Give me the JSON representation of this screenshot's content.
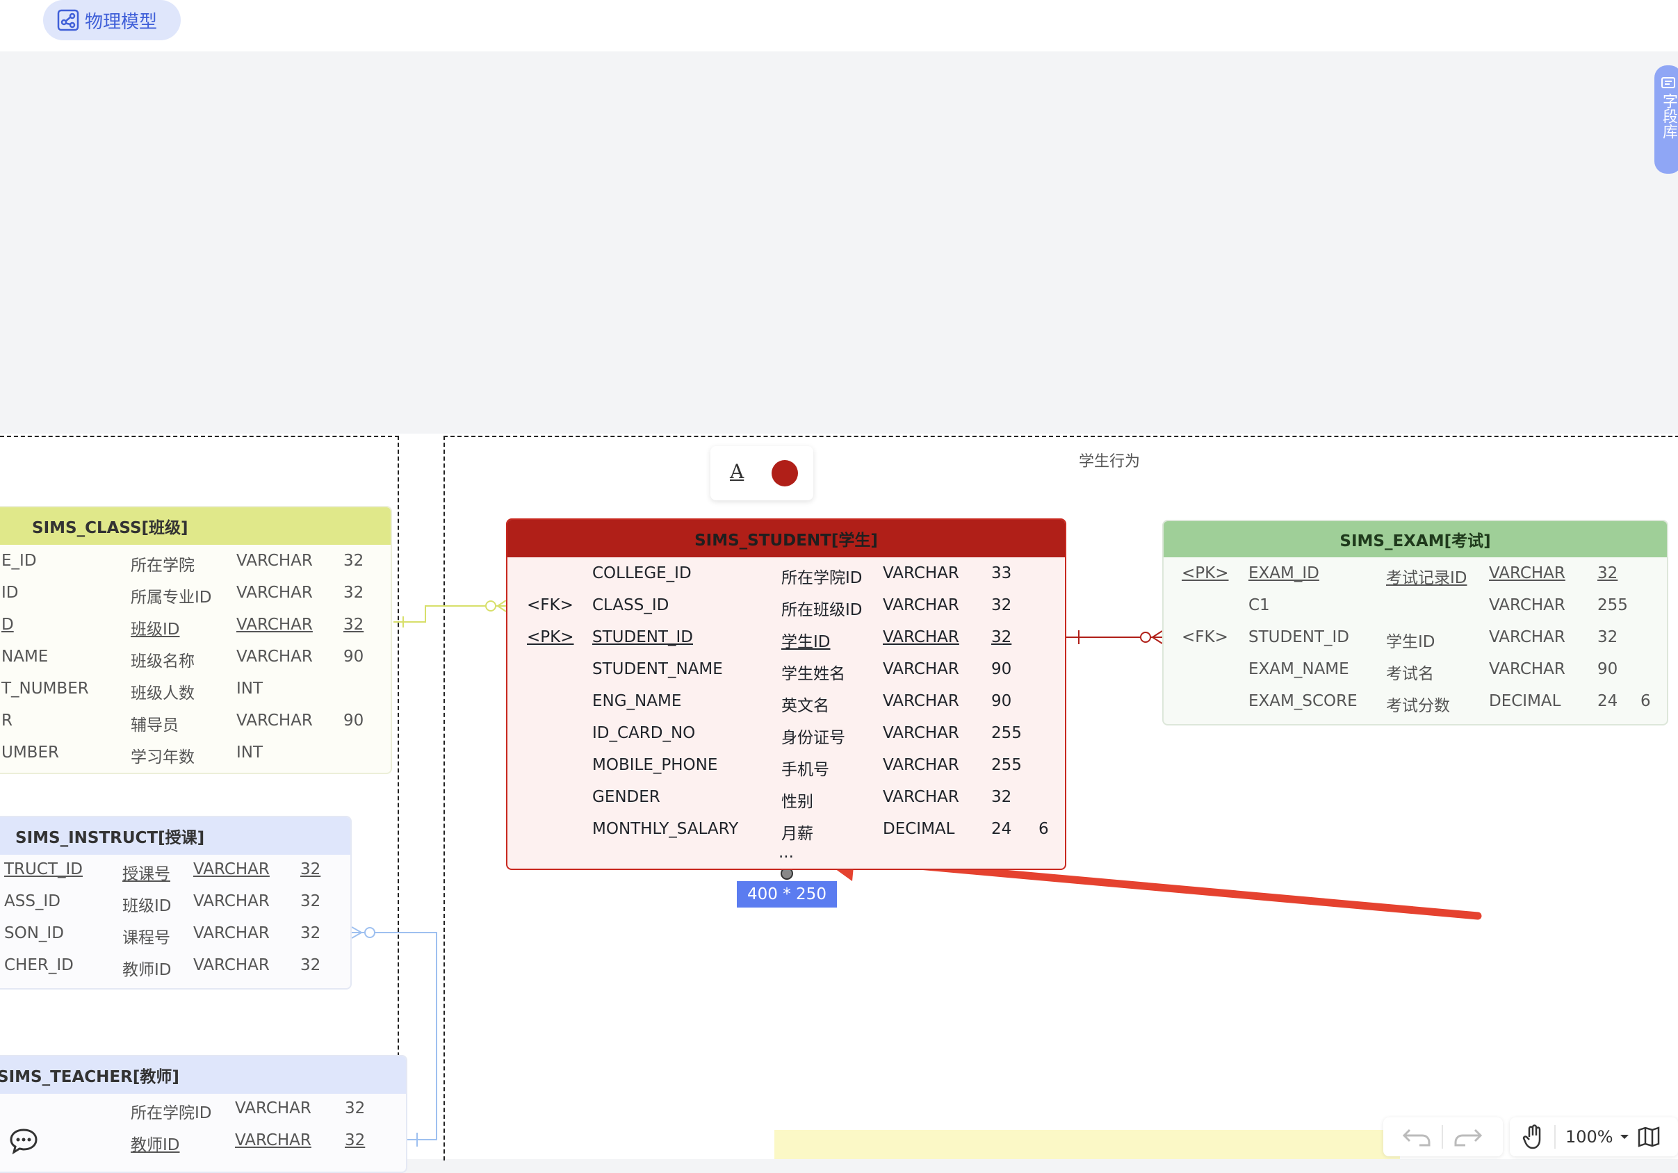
{
  "header": {
    "model_label": "物理模型"
  },
  "side_tab": {
    "label": "字段库"
  },
  "groups": {
    "student_behavior": "学生行为"
  },
  "colors": {
    "student_header": "#b01f18",
    "class_header": "#e0e88a",
    "exam_header": "#9fcf98",
    "instruct_header": "#dfe6fb",
    "accent": "#5b7cf0",
    "arrow": "#e5422f"
  },
  "style_toolbar": {
    "text_icon": "A",
    "color_icon": "red-circle"
  },
  "size_badge": "400 * 250",
  "more_rows": "...",
  "zoom": {
    "value": "100%"
  },
  "tables": {
    "student": {
      "title": "SIMS_STUDENT[学生]",
      "rows": [
        {
          "key": "",
          "name": "COLLEGE_ID",
          "label": "所在学院ID",
          "type": "VARCHAR",
          "len": "33",
          "scale": ""
        },
        {
          "key": "<FK>",
          "name": "CLASS_ID",
          "label": "所在班级ID",
          "type": "VARCHAR",
          "len": "32",
          "scale": ""
        },
        {
          "key": "<PK>",
          "name": "STUDENT_ID",
          "label": "学生ID",
          "type": "VARCHAR",
          "len": "32",
          "scale": ""
        },
        {
          "key": "",
          "name": "STUDENT_NAME",
          "label": "学生姓名",
          "type": "VARCHAR",
          "len": "90",
          "scale": ""
        },
        {
          "key": "",
          "name": "ENG_NAME",
          "label": "英文名",
          "type": "VARCHAR",
          "len": "90",
          "scale": ""
        },
        {
          "key": "",
          "name": "ID_CARD_NO",
          "label": "身份证号",
          "type": "VARCHAR",
          "len": "255",
          "scale": ""
        },
        {
          "key": "",
          "name": "MOBILE_PHONE",
          "label": "手机号",
          "type": "VARCHAR",
          "len": "255",
          "scale": ""
        },
        {
          "key": "",
          "name": "GENDER",
          "label": "性别",
          "type": "VARCHAR",
          "len": "32",
          "scale": ""
        },
        {
          "key": "",
          "name": "MONTHLY_SALARY",
          "label": "月薪",
          "type": "DECIMAL",
          "len": "24",
          "scale": "6"
        }
      ]
    },
    "exam": {
      "title": "SIMS_EXAM[考试]",
      "rows": [
        {
          "key": "<PK>",
          "name": "EXAM_ID",
          "label": "考试记录ID",
          "type": "VARCHAR",
          "len": "32",
          "scale": ""
        },
        {
          "key": "",
          "name": "C1",
          "label": "",
          "type": "VARCHAR",
          "len": "255",
          "scale": ""
        },
        {
          "key": "<FK>",
          "name": "STUDENT_ID",
          "label": "学生ID",
          "type": "VARCHAR",
          "len": "32",
          "scale": ""
        },
        {
          "key": "",
          "name": "EXAM_NAME",
          "label": "考试名",
          "type": "VARCHAR",
          "len": "90",
          "scale": ""
        },
        {
          "key": "",
          "name": "EXAM_SCORE",
          "label": "考试分数",
          "type": "DECIMAL",
          "len": "24",
          "scale": "6"
        }
      ]
    },
    "class": {
      "title": "SIMS_CLASS[班级]",
      "rows": [
        {
          "name": "E_ID",
          "label": "所在学院",
          "type": "VARCHAR",
          "len": "32"
        },
        {
          "name": "ID",
          "label": "所属专业ID",
          "type": "VARCHAR",
          "len": "32"
        },
        {
          "name": "D",
          "label": "班级ID",
          "type": "VARCHAR",
          "len": "32"
        },
        {
          "name": "NAME",
          "label": "班级名称",
          "type": "VARCHAR",
          "len": "90"
        },
        {
          "name": "T_NUMBER",
          "label": "班级人数",
          "type": "INT",
          "len": ""
        },
        {
          "name": "R",
          "label": "辅导员",
          "type": "VARCHAR",
          "len": "90"
        },
        {
          "name": "UMBER",
          "label": "学习年数",
          "type": "INT",
          "len": ""
        }
      ]
    },
    "instruct": {
      "title": "SIMS_INSTRUCT[授课]",
      "rows": [
        {
          "name": "TRUCT_ID",
          "label": "授课号",
          "type": "VARCHAR",
          "len": "32"
        },
        {
          "name": "ASS_ID",
          "label": "班级ID",
          "type": "VARCHAR",
          "len": "32"
        },
        {
          "name": "SON_ID",
          "label": "课程号",
          "type": "VARCHAR",
          "len": "32"
        },
        {
          "name": "CHER_ID",
          "label": "教师ID",
          "type": "VARCHAR",
          "len": "32"
        }
      ]
    },
    "teacher": {
      "title": "SIMS_TEACHER[教师]",
      "rows": [
        {
          "label": "所在学院ID",
          "type": "VARCHAR",
          "len": "32"
        },
        {
          "label": "教师ID",
          "type": "VARCHAR",
          "len": "32"
        }
      ]
    }
  }
}
